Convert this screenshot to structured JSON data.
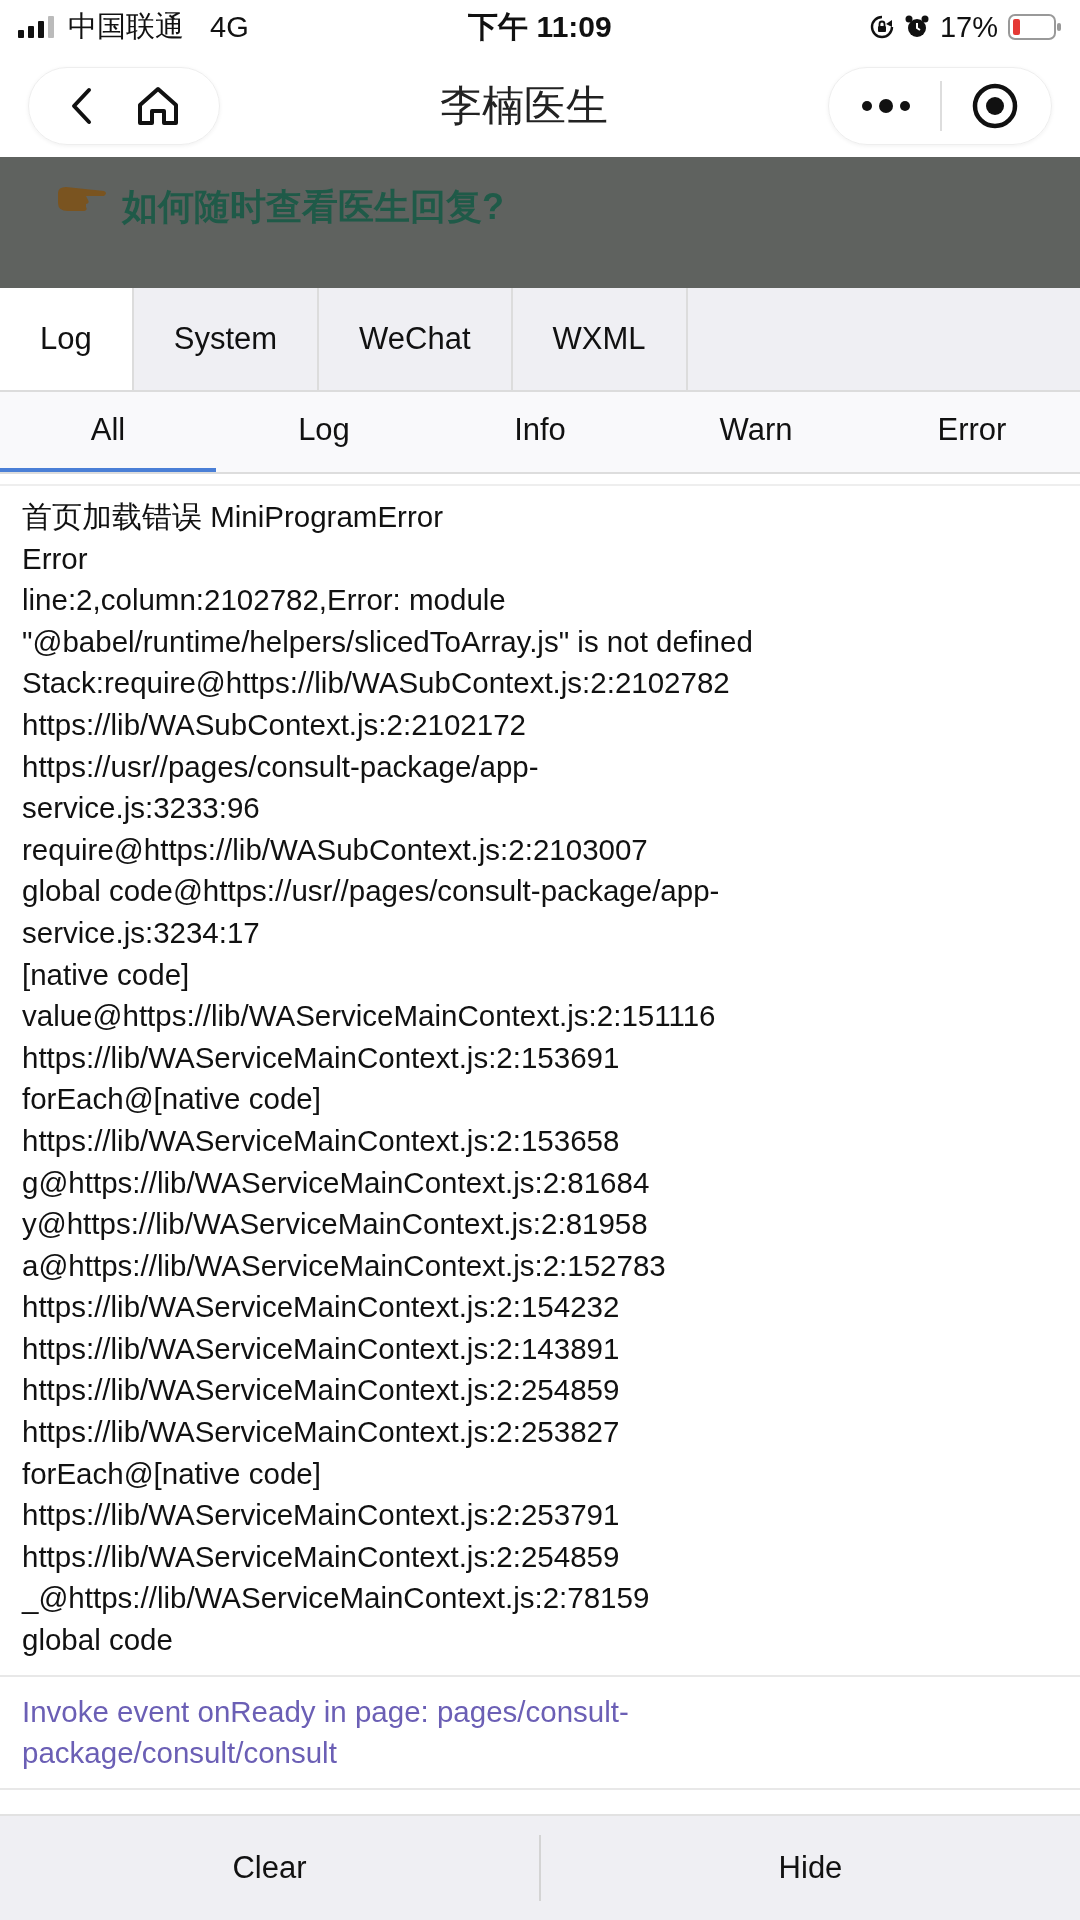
{
  "status_bar": {
    "carrier": "中国联通",
    "network": "4G",
    "time": "下午 11:09",
    "battery": "17%"
  },
  "nav": {
    "title": "李楠医生"
  },
  "banner": {
    "text": "如何随时查看医生回复?"
  },
  "tabs": [
    {
      "label": "Log",
      "selected": true
    },
    {
      "label": "System",
      "selected": false
    },
    {
      "label": "WeChat",
      "selected": false
    },
    {
      "label": "WXML",
      "selected": false
    }
  ],
  "filters": [
    {
      "label": "All",
      "selected": true
    },
    {
      "label": "Log",
      "selected": false
    },
    {
      "label": "Info",
      "selected": false
    },
    {
      "label": "Warn",
      "selected": false
    },
    {
      "label": "Error",
      "selected": false
    }
  ],
  "entries": [
    {
      "kind": "error",
      "lines": [
        "首页加载错误 MiniProgramError",
        "Error",
        "line:2,column:2102782,Error: module",
        "\"@babel/runtime/helpers/slicedToArray.js\" is not defined",
        "Stack:require@https://lib/WASubContext.js:2:2102782",
        "https://lib/WASubContext.js:2:2102172",
        "https://usr//pages/consult-package/app-",
        "service.js:3233:96",
        "require@https://lib/WASubContext.js:2:2103007",
        "global code@https://usr//pages/consult-package/app-",
        "service.js:3234:17",
        "[native code]",
        "value@https://lib/WAServiceMainContext.js:2:151116",
        "https://lib/WAServiceMainContext.js:2:153691",
        "forEach@[native code]",
        "https://lib/WAServiceMainContext.js:2:153658",
        "g@https://lib/WAServiceMainContext.js:2:81684",
        "y@https://lib/WAServiceMainContext.js:2:81958",
        "a@https://lib/WAServiceMainContext.js:2:152783",
        "https://lib/WAServiceMainContext.js:2:154232",
        "https://lib/WAServiceMainContext.js:2:143891",
        "https://lib/WAServiceMainContext.js:2:254859",
        "https://lib/WAServiceMainContext.js:2:253827",
        "forEach@[native code]",
        "https://lib/WAServiceMainContext.js:2:253791",
        "https://lib/WAServiceMainContext.js:2:254859",
        "_@https://lib/WAServiceMainContext.js:2:78159",
        "global code"
      ]
    },
    {
      "kind": "info",
      "lines": [
        "Invoke event onReady in page: pages/consult-",
        "package/consult/consult"
      ]
    }
  ],
  "buttons": [
    "Clear",
    "Hide"
  ]
}
